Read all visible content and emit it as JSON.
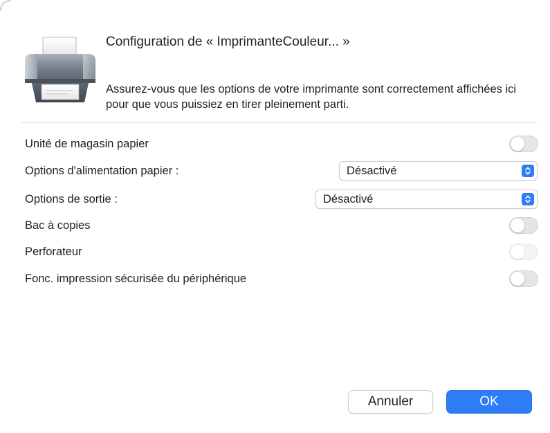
{
  "dialog": {
    "title": "Configuration de « ImprimanteCouleur... »",
    "description": "Assurez-vous que les options de votre imprimante sont correctement affichées ici pour que vous puissiez en tirer pleinement parti.",
    "icon": "printer-icon"
  },
  "options": {
    "paper_tray_unit": {
      "label": "Unité de magasin papier",
      "on": false
    },
    "paper_feed_options": {
      "label": "Options d'alimentation papier :",
      "value": "Désactivé"
    },
    "output_options": {
      "label": "Options de sortie :",
      "value": "Désactivé"
    },
    "copy_tray": {
      "label": "Bac à copies",
      "on": false
    },
    "puncher": {
      "label": "Perforateur",
      "on": false,
      "enabled": false
    },
    "secure_print": {
      "label": "Fonc. impression sécurisée du périphérique",
      "on": false
    }
  },
  "buttons": {
    "cancel_label": "Annuler",
    "ok_label": "OK"
  },
  "colors": {
    "accent": "#2e7df6",
    "toggle_off": "#e5e5e7",
    "divider": "#dcdcdc"
  }
}
